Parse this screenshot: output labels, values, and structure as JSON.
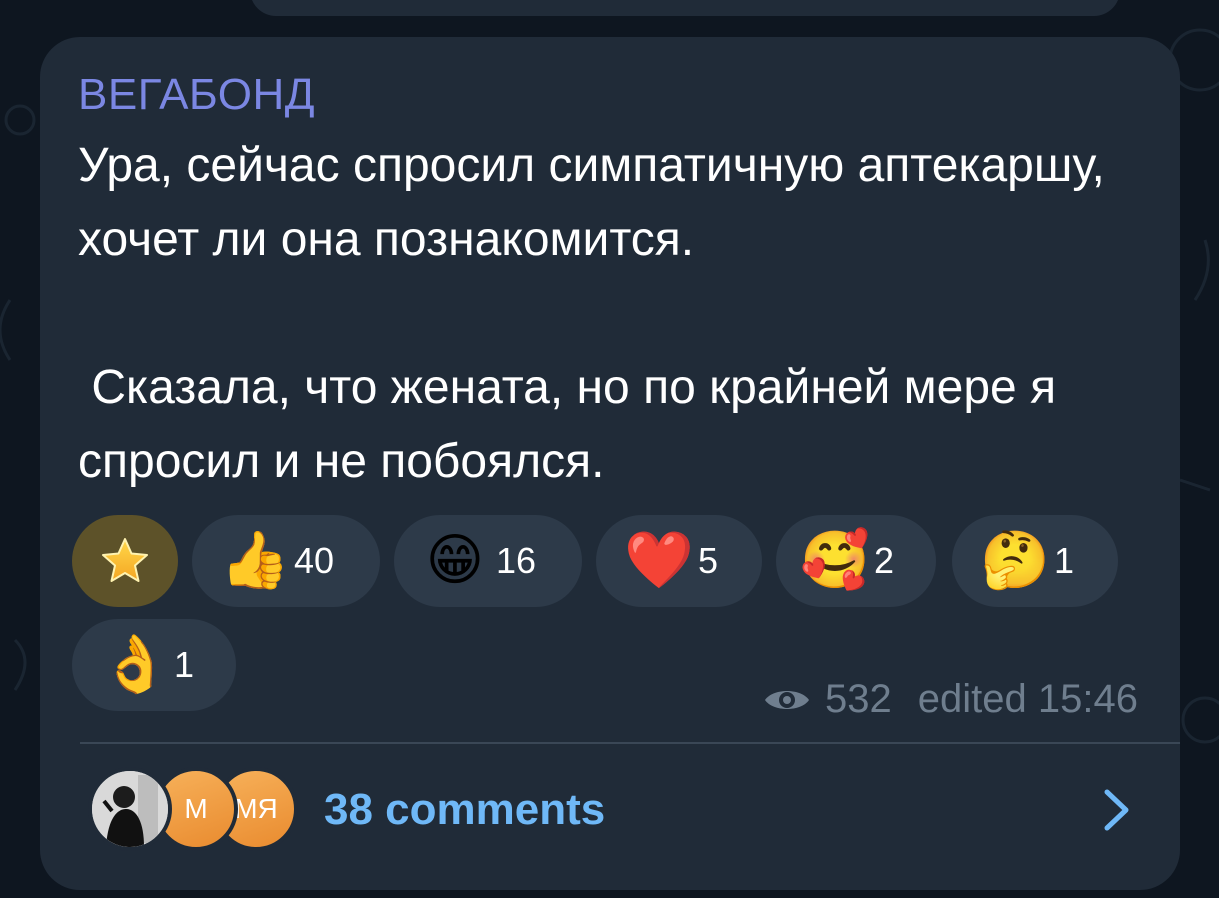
{
  "post": {
    "author": "ВЕГАБОНД",
    "text": "Ура, сейчас спросил симпатичную аптекаршу, хочет ли она познакомится.\n\n Сказала, что жената, но по крайней мере я спросил и не побоялся."
  },
  "reactions": [
    {
      "emoji": "star-icon",
      "count": ""
    },
    {
      "emoji": "👍",
      "count": "40"
    },
    {
      "emoji": "😁",
      "count": "16"
    },
    {
      "emoji": "❤️",
      "count": "5"
    },
    {
      "emoji": "🥰",
      "count": "2"
    },
    {
      "emoji": "🤔",
      "count": "1"
    },
    {
      "emoji": "👌",
      "count": "1"
    }
  ],
  "meta": {
    "views": "532",
    "edited": "edited 15:46"
  },
  "comments": {
    "label": "38 comments",
    "avatars": [
      {
        "initials": ""
      },
      {
        "initials": "М"
      },
      {
        "initials": "МЯ"
      }
    ]
  },
  "colors": {
    "bubble": "#202b38",
    "author": "#7b87e3",
    "link": "#6fb8f7",
    "paid_reaction": "#5d5229"
  }
}
